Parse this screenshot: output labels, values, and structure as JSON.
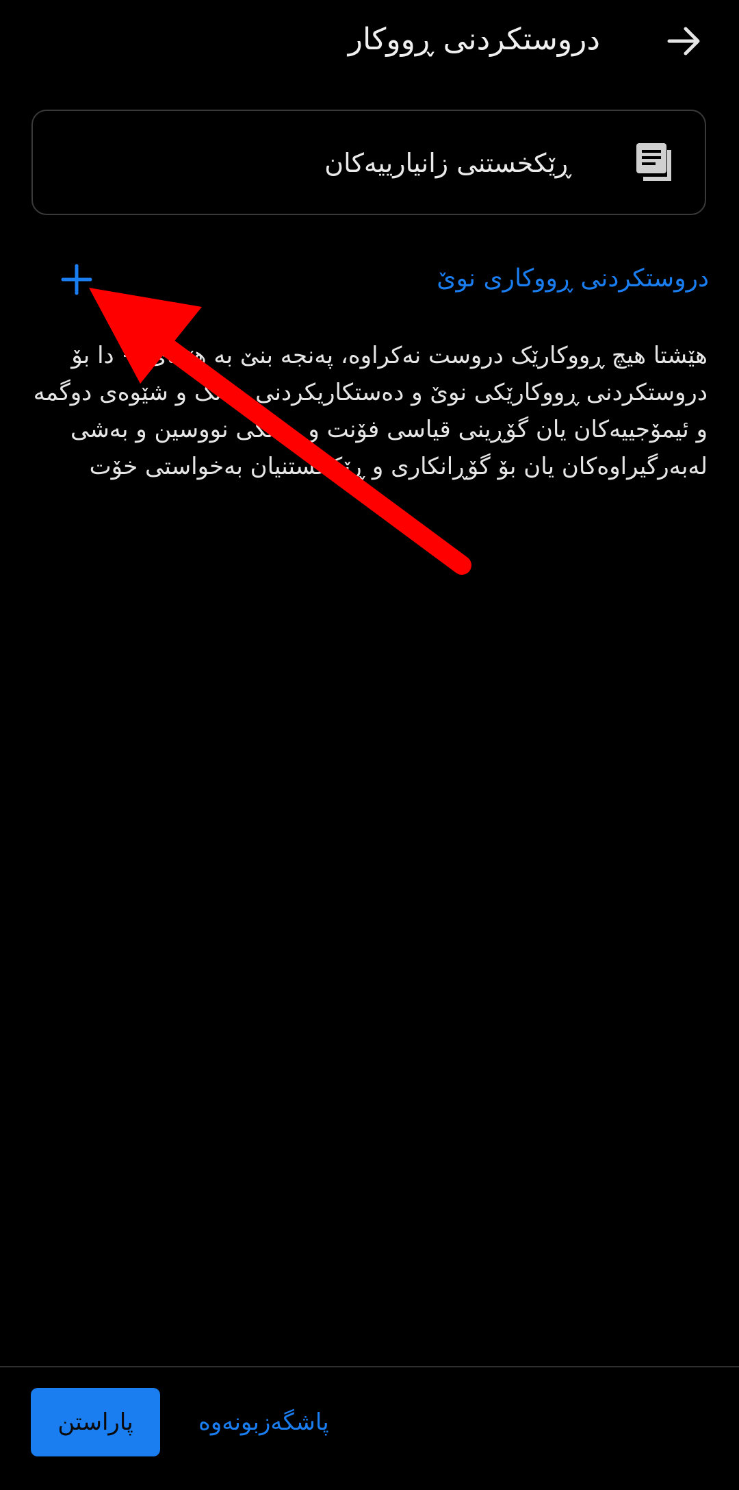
{
  "header": {
    "title": "دروستکردنی ڕووکار",
    "back_icon": "arrow-right-icon"
  },
  "data_card": {
    "label": "ڕێکخستنی زانیارییەکان",
    "icon": "documents-icon"
  },
  "create_new": {
    "label": "دروستکردنی ڕووکاری نوێ",
    "icon": "plus-icon"
  },
  "help_text": "هێشتا هیچ ڕووکارێک دروست نەکراوە، پەنجە بنێ بە هێمای + دا بۆ دروستکردنی ڕووکارێکی نوێ و دەستکاریکردنی ڕەنگ و شێوەی دوگمە و ئیمۆجییەکان یان گۆڕینی قیاسی فۆنت و ڕەنگی نووسین و بەشی لەبەرگیراوەکان یان بۆ گۆڕانکاری و ڕێکخستنیان بەخواستی خۆت",
  "bottom": {
    "save_label": "پاراستن",
    "cancel_label": "پاشگەزبونەوە"
  },
  "colors": {
    "background": "#000000",
    "accent": "#1a7df0",
    "text": "#e6e6e6",
    "card_border": "#3a3a3a",
    "annotation": "#ff0000"
  }
}
